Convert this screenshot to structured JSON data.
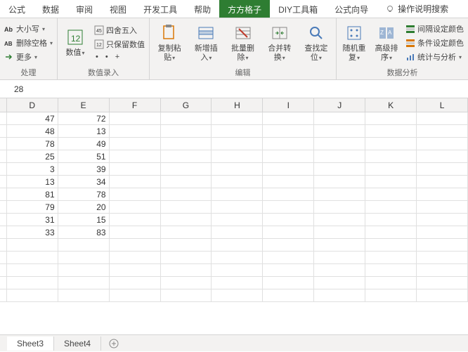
{
  "tabs": [
    "公式",
    "数据",
    "审阅",
    "视图",
    "开发工具",
    "帮助",
    "方方格子",
    "DIY工具箱",
    "公式向导",
    "操作说明搜索"
  ],
  "active_tab_index": 6,
  "ribbon": {
    "group1": {
      "label": "处理",
      "items": [
        "大小写",
        "删除空格",
        "更多"
      ]
    },
    "group2": {
      "label": "数值录入",
      "big": "数值",
      "items": [
        "四舍五入",
        "只保留数值"
      ]
    },
    "group3": {
      "label": "编辑",
      "bigs": [
        "复制粘贴",
        "新增插入",
        "批量删除",
        "合并转换",
        "查找定位"
      ]
    },
    "group4": {
      "label": "数据分析",
      "bigs": [
        "随机重复",
        "高级排序"
      ],
      "items": [
        "间隔设定颜色",
        "条件设定颜色",
        "统计与分析"
      ]
    }
  },
  "formula_value": "28",
  "columns": [
    "D",
    "E",
    "F",
    "G",
    "H",
    "I",
    "J",
    "K",
    "L"
  ],
  "rows": [
    {
      "D": "47",
      "E": "72"
    },
    {
      "D": "48",
      "E": "13"
    },
    {
      "D": "78",
      "E": "49"
    },
    {
      "D": "25",
      "E": "51"
    },
    {
      "D": "3",
      "E": "39"
    },
    {
      "D": "13",
      "E": "34"
    },
    {
      "D": "81",
      "E": "78"
    },
    {
      "D": "79",
      "E": "20"
    },
    {
      "D": "31",
      "E": "15"
    },
    {
      "D": "33",
      "E": "83"
    },
    {},
    {},
    {},
    {},
    {}
  ],
  "sheets": [
    "Sheet3",
    "Sheet4"
  ],
  "chart_data": {
    "type": "table",
    "columns": [
      "D",
      "E"
    ],
    "values": [
      [
        47,
        72
      ],
      [
        48,
        13
      ],
      [
        78,
        49
      ],
      [
        25,
        51
      ],
      [
        3,
        39
      ],
      [
        13,
        34
      ],
      [
        81,
        78
      ],
      [
        79,
        20
      ],
      [
        31,
        15
      ],
      [
        33,
        83
      ]
    ]
  }
}
